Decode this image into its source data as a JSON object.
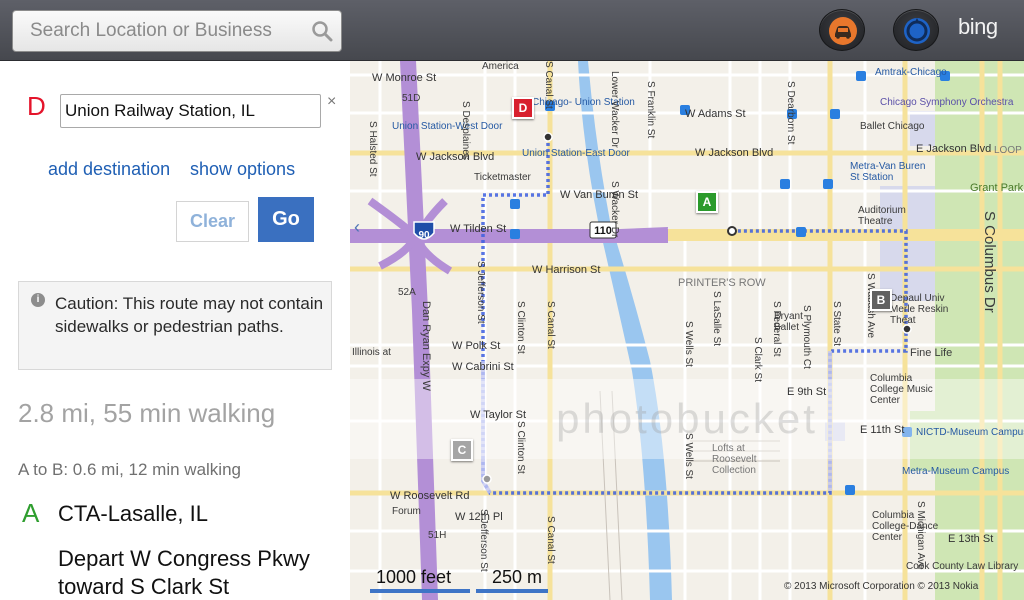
{
  "search": {
    "placeholder": "Search Location or Business"
  },
  "header": {
    "brand": "bing"
  },
  "panel": {
    "destination_letter": "D",
    "destination_value": "Union Railway Station, IL",
    "clear_x": "×",
    "add_destination": "add destination",
    "show_options": "show options",
    "clear_label": "Clear",
    "go_label": "Go",
    "caution_icon": "i",
    "caution_text": "Caution: This route may not contain sidewalks or pedestrian paths.",
    "summary": "2.8 mi, 55 min walking",
    "leg": "A to B: 0.6 mi, 12 min walking",
    "step_letter": "A",
    "step_title": "CTA-Lasalle, IL",
    "step_desc": "Depart W Congress Pkwy toward S Clark St"
  },
  "map": {
    "collapse_arrow": "‹",
    "markers": {
      "d": "D",
      "a": "A",
      "b": "B",
      "c": "C"
    },
    "highway_shields": {
      "i90": "90",
      "r110": "110"
    },
    "labels": {
      "w_monroe": "W Monroe St",
      "america": "America",
      "chicago_union": "Chicago- Union Station",
      "s_desplaines": "S Desplaines",
      "w_adams": "W Adams St",
      "union_west": "Union Station-West Door",
      "union_east": "Union Station-East Door",
      "w_jackson_left": "W Jackson Blvd",
      "w_jackson_mid": "W Jackson Blvd",
      "ticketmaster": "Ticketmaster",
      "w_van_buren": "W Van Buren St",
      "w_tilden": "W Tilden St",
      "w_harrison": "W Harrison St",
      "printers_row": "PRINTER'S ROW",
      "w_polk": "W Polk St",
      "w_cabrini": "W Cabrini St",
      "illinois_at": "Illinois at",
      "w_taylor": "W Taylor St",
      "w_roosevelt": "W Roosevelt Rd",
      "forum": "Forum",
      "w_12th": "W 12th Pl",
      "amtrak": "Amtrak-Chicago",
      "symphony": "Chicago Symphony Orchestra",
      "ballet": "Ballet Chicago",
      "e_jackson": "E Jackson Blvd",
      "loop": "LOOP",
      "metra_van_buren": "Metra-Van Buren St Station",
      "grant_park": "Grant Park",
      "auditorium": "Auditorium Theatre",
      "merle": "Depaul Univ Merle Reskin Theat",
      "s_columbus": "S Columbus Dr",
      "fine_life": "Fine Life",
      "columbia_music": "Columbia College Music Center",
      "e_9th": "E 9th St",
      "e_11th": "E 11th St",
      "nictd": "NICTD-Museum Campus",
      "metra_museum": "Metra-Museum Campus",
      "columbia_dance": "Columbia College-Dance Center",
      "e_13th": "E 13th St",
      "cook_county": "Cook County Law Library",
      "lofts": "Lofts at Roosevelt Collection",
      "bryant": "Bryant Ballet",
      "dan_ryan": "Dan Ryan Expy W",
      "ramp_52a": "52A",
      "ramp_51h": "51H",
      "ramp_51d": "51D",
      "s_halsted": "S Halsted St",
      "s_jefferson": "S Jefferson St",
      "s_jefferson_2": "S Jefferson St",
      "s_clinton": "S Clinton St",
      "s_clinton_2": "S Clinton St",
      "s_canal": "S Canal St",
      "s_canal_2": "S Canal St",
      "s_canal_top": "S Canal St",
      "s_wacker": "S Wacker Dr",
      "lower_wacker": "Lower Wacker Dr",
      "s_franklin": "S Franklin St",
      "s_wells": "S Wells St",
      "s_lasalle": "S LaSalle St",
      "s_clark": "S Clark St",
      "s_dearborn": "S Dearborn St",
      "s_federal": "S Federal St",
      "s_plymouth": "S Plymouth Ct",
      "s_state": "S State St",
      "s_wabash": "S Wabash Ave",
      "s_michigan": "S Michigan Ave",
      "s_wells_2": "S Wells St"
    },
    "watermark": "photobucket",
    "scale_feet": "1000 feet",
    "scale_m": "250 m",
    "copyright": "© 2013 Microsoft Corporation   © 2013 Nokia"
  },
  "colors": {
    "highway": "#b38fd6",
    "route": "#3b5ee0",
    "park": "#cde6b0",
    "river": "#9ac6ef",
    "transit": "#2a7fe0"
  }
}
